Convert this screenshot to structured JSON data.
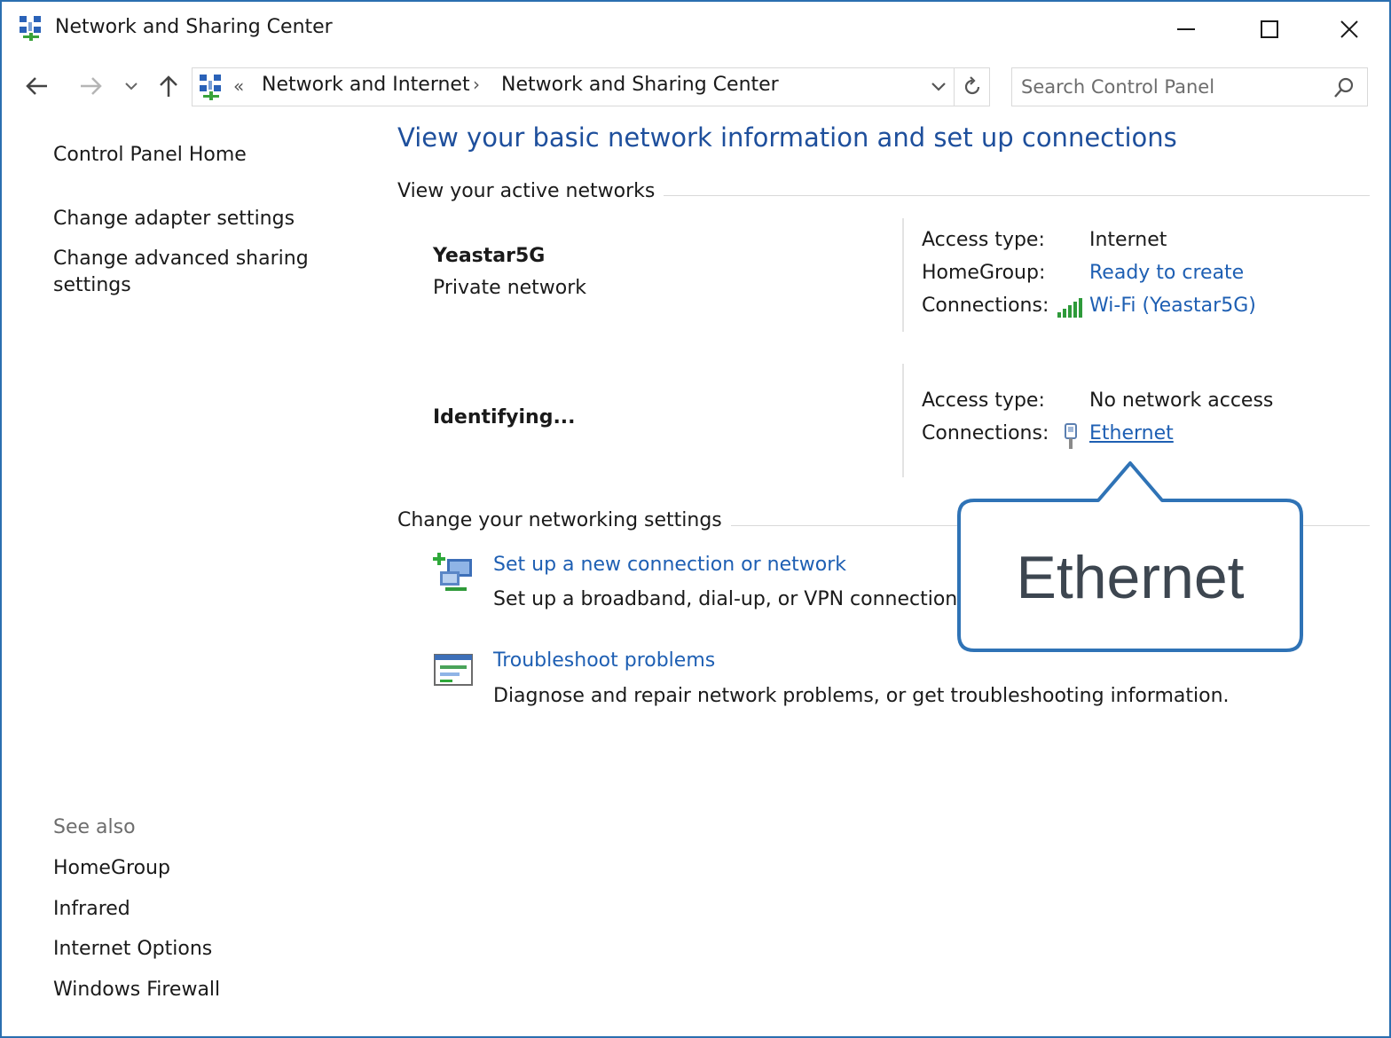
{
  "window": {
    "title": "Network and Sharing Center",
    "controls": {
      "minimize": "minimize",
      "maximize": "maximize",
      "close": "close"
    }
  },
  "address_bar": {
    "overflow": "«",
    "breadcrumbs": [
      "Network and Internet",
      "Network and Sharing Center"
    ],
    "separator": "›"
  },
  "search": {
    "placeholder": "Search Control Panel",
    "value": ""
  },
  "left_pane": {
    "links": [
      "Control Panel Home",
      "Change adapter settings",
      "Change advanced sharing settings"
    ],
    "see_also": {
      "heading": "See also",
      "links": [
        "HomeGroup",
        "Infrared",
        "Internet Options",
        "Windows Firewall"
      ]
    }
  },
  "main": {
    "title": "View your basic network information and set up connections",
    "active_networks_heading": "View your active networks",
    "networks": [
      {
        "name": "Yeastar5G",
        "category": "Private network",
        "properties": [
          {
            "label": "Access type:",
            "value": "Internet"
          },
          {
            "label": "HomeGroup:",
            "value": "Ready to create"
          },
          {
            "label": "Connections:",
            "value": "Wi-Fi (Yeastar5G)",
            "icon": "wifi-signal-icon"
          }
        ]
      },
      {
        "name": "Identifying...",
        "category": "",
        "properties": [
          {
            "label": "Access type:",
            "value": "No network access"
          },
          {
            "label": "Connections:",
            "value": "Ethernet",
            "icon": "ethernet-icon"
          }
        ]
      }
    ],
    "settings_heading": "Change your networking settings",
    "tasks": [
      {
        "title": "Set up a new connection or network",
        "description": "Set up a broadband, dial-up, or VPN connection; or set up a router or access point.",
        "icon": "new-connection-icon"
      },
      {
        "title": "Troubleshoot problems",
        "description": "Diagnose and repair network problems, or get troubleshooting information.",
        "icon": "troubleshoot-icon"
      }
    ]
  },
  "callout": {
    "text": "Ethernet"
  },
  "colors": {
    "link": "#1e5fb3",
    "title": "#1e4f9c",
    "border": "#2b6fb0",
    "callout_border": "#2f73b6"
  }
}
